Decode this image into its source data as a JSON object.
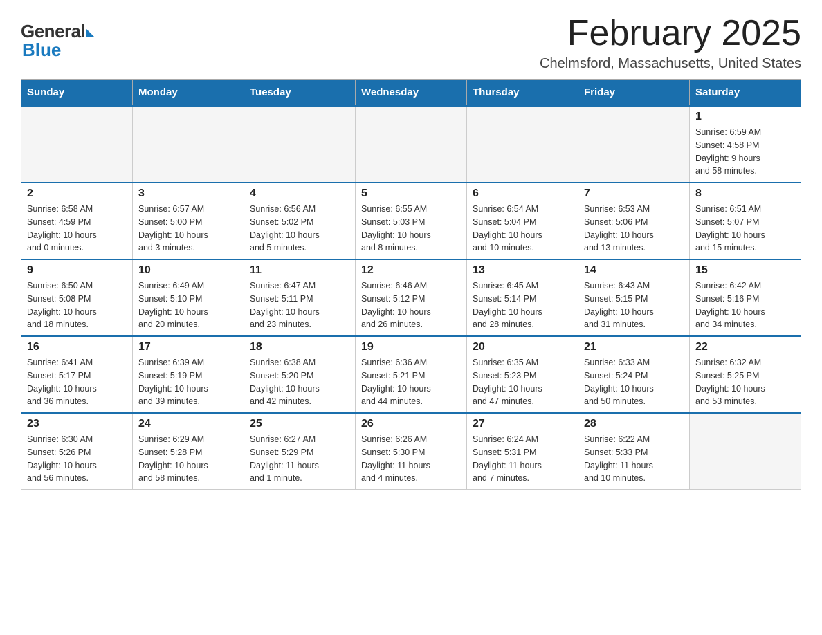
{
  "logo": {
    "general": "General",
    "blue": "Blue"
  },
  "header": {
    "title": "February 2025",
    "subtitle": "Chelmsford, Massachusetts, United States"
  },
  "weekdays": [
    "Sunday",
    "Monday",
    "Tuesday",
    "Wednesday",
    "Thursday",
    "Friday",
    "Saturday"
  ],
  "weeks": [
    [
      {
        "day": "",
        "info": ""
      },
      {
        "day": "",
        "info": ""
      },
      {
        "day": "",
        "info": ""
      },
      {
        "day": "",
        "info": ""
      },
      {
        "day": "",
        "info": ""
      },
      {
        "day": "",
        "info": ""
      },
      {
        "day": "1",
        "info": "Sunrise: 6:59 AM\nSunset: 4:58 PM\nDaylight: 9 hours\nand 58 minutes."
      }
    ],
    [
      {
        "day": "2",
        "info": "Sunrise: 6:58 AM\nSunset: 4:59 PM\nDaylight: 10 hours\nand 0 minutes."
      },
      {
        "day": "3",
        "info": "Sunrise: 6:57 AM\nSunset: 5:00 PM\nDaylight: 10 hours\nand 3 minutes."
      },
      {
        "day": "4",
        "info": "Sunrise: 6:56 AM\nSunset: 5:02 PM\nDaylight: 10 hours\nand 5 minutes."
      },
      {
        "day": "5",
        "info": "Sunrise: 6:55 AM\nSunset: 5:03 PM\nDaylight: 10 hours\nand 8 minutes."
      },
      {
        "day": "6",
        "info": "Sunrise: 6:54 AM\nSunset: 5:04 PM\nDaylight: 10 hours\nand 10 minutes."
      },
      {
        "day": "7",
        "info": "Sunrise: 6:53 AM\nSunset: 5:06 PM\nDaylight: 10 hours\nand 13 minutes."
      },
      {
        "day": "8",
        "info": "Sunrise: 6:51 AM\nSunset: 5:07 PM\nDaylight: 10 hours\nand 15 minutes."
      }
    ],
    [
      {
        "day": "9",
        "info": "Sunrise: 6:50 AM\nSunset: 5:08 PM\nDaylight: 10 hours\nand 18 minutes."
      },
      {
        "day": "10",
        "info": "Sunrise: 6:49 AM\nSunset: 5:10 PM\nDaylight: 10 hours\nand 20 minutes."
      },
      {
        "day": "11",
        "info": "Sunrise: 6:47 AM\nSunset: 5:11 PM\nDaylight: 10 hours\nand 23 minutes."
      },
      {
        "day": "12",
        "info": "Sunrise: 6:46 AM\nSunset: 5:12 PM\nDaylight: 10 hours\nand 26 minutes."
      },
      {
        "day": "13",
        "info": "Sunrise: 6:45 AM\nSunset: 5:14 PM\nDaylight: 10 hours\nand 28 minutes."
      },
      {
        "day": "14",
        "info": "Sunrise: 6:43 AM\nSunset: 5:15 PM\nDaylight: 10 hours\nand 31 minutes."
      },
      {
        "day": "15",
        "info": "Sunrise: 6:42 AM\nSunset: 5:16 PM\nDaylight: 10 hours\nand 34 minutes."
      }
    ],
    [
      {
        "day": "16",
        "info": "Sunrise: 6:41 AM\nSunset: 5:17 PM\nDaylight: 10 hours\nand 36 minutes."
      },
      {
        "day": "17",
        "info": "Sunrise: 6:39 AM\nSunset: 5:19 PM\nDaylight: 10 hours\nand 39 minutes."
      },
      {
        "day": "18",
        "info": "Sunrise: 6:38 AM\nSunset: 5:20 PM\nDaylight: 10 hours\nand 42 minutes."
      },
      {
        "day": "19",
        "info": "Sunrise: 6:36 AM\nSunset: 5:21 PM\nDaylight: 10 hours\nand 44 minutes."
      },
      {
        "day": "20",
        "info": "Sunrise: 6:35 AM\nSunset: 5:23 PM\nDaylight: 10 hours\nand 47 minutes."
      },
      {
        "day": "21",
        "info": "Sunrise: 6:33 AM\nSunset: 5:24 PM\nDaylight: 10 hours\nand 50 minutes."
      },
      {
        "day": "22",
        "info": "Sunrise: 6:32 AM\nSunset: 5:25 PM\nDaylight: 10 hours\nand 53 minutes."
      }
    ],
    [
      {
        "day": "23",
        "info": "Sunrise: 6:30 AM\nSunset: 5:26 PM\nDaylight: 10 hours\nand 56 minutes."
      },
      {
        "day": "24",
        "info": "Sunrise: 6:29 AM\nSunset: 5:28 PM\nDaylight: 10 hours\nand 58 minutes."
      },
      {
        "day": "25",
        "info": "Sunrise: 6:27 AM\nSunset: 5:29 PM\nDaylight: 11 hours\nand 1 minute."
      },
      {
        "day": "26",
        "info": "Sunrise: 6:26 AM\nSunset: 5:30 PM\nDaylight: 11 hours\nand 4 minutes."
      },
      {
        "day": "27",
        "info": "Sunrise: 6:24 AM\nSunset: 5:31 PM\nDaylight: 11 hours\nand 7 minutes."
      },
      {
        "day": "28",
        "info": "Sunrise: 6:22 AM\nSunset: 5:33 PM\nDaylight: 11 hours\nand 10 minutes."
      },
      {
        "day": "",
        "info": ""
      }
    ]
  ]
}
